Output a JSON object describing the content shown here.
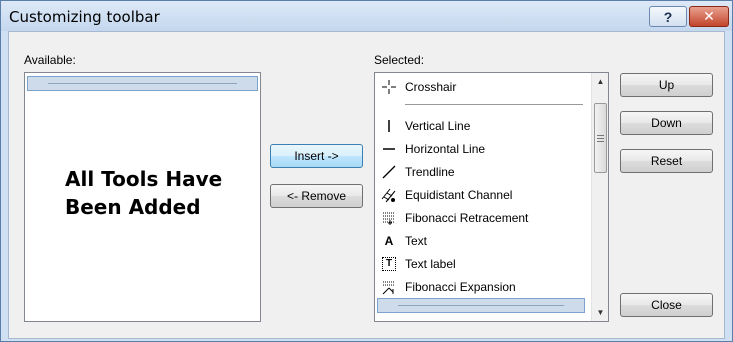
{
  "window": {
    "title": "Customizing toolbar",
    "help_label": "?",
    "close_label": "✕"
  },
  "available": {
    "label": "Available:",
    "overlay_line1": "All Tools Have",
    "overlay_line2": "Been Added"
  },
  "buttons": {
    "insert": "Insert ->",
    "remove": "<- Remove",
    "up": "Up",
    "down": "Down",
    "reset": "Reset",
    "close": "Close"
  },
  "selected": {
    "label": "Selected:",
    "items": [
      {
        "label": "Crosshair",
        "icon": "crosshair-icon"
      },
      {
        "label": "Vertical Line",
        "icon": "vertical-line-icon"
      },
      {
        "label": "Horizontal Line",
        "icon": "horizontal-line-icon"
      },
      {
        "label": "Trendline",
        "icon": "trendline-icon"
      },
      {
        "label": "Equidistant Channel",
        "icon": "equidistant-channel-icon"
      },
      {
        "label": "Fibonacci Retracement",
        "icon": "fibonacci-retracement-icon"
      },
      {
        "label": "Text",
        "icon": "text-icon",
        "glyph": "A"
      },
      {
        "label": "Text label",
        "icon": "text-label-icon",
        "glyph": "T"
      },
      {
        "label": "Fibonacci Expansion",
        "icon": "fibonacci-expansion-icon"
      }
    ]
  }
}
